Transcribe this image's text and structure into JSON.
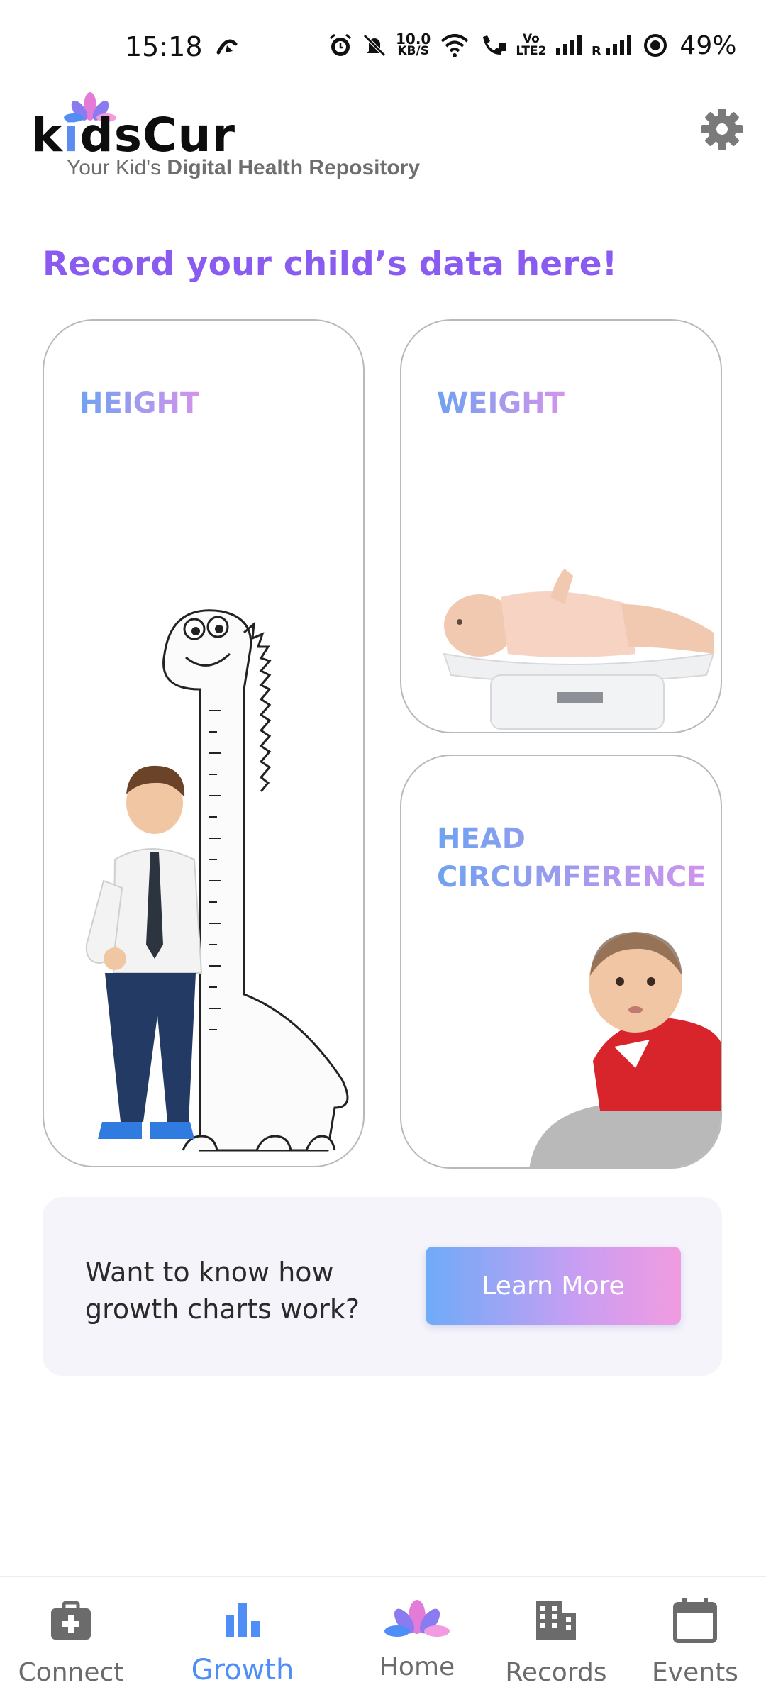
{
  "status_bar": {
    "time": "15:18",
    "net_speed_value": "10.0",
    "net_speed_unit": "KB/S",
    "volte": "Vo",
    "lte": "LTE2",
    "battery": "49%",
    "icons": [
      "hotspot-icon",
      "alarm-icon",
      "mute-icon",
      "wifi-icon",
      "wifi-call-icon",
      "signal-icon",
      "roaming-signal-icon",
      "battery-saver-icon"
    ]
  },
  "header": {
    "logo_text_prefix": "k",
    "logo_text_accent": "i",
    "logo_text_suffix": "dsCur",
    "tagline_prefix": "Your Kid's ",
    "tagline_bold": "Digital Health Repository",
    "settings_icon": "gear-icon"
  },
  "main": {
    "title": "Record your child’s data here!",
    "cards": {
      "height": {
        "label": "HEIGHT"
      },
      "weight": {
        "label": "WEIGHT"
      },
      "head": {
        "label": "HEAD CIRCUMFERENCE"
      }
    }
  },
  "info_banner": {
    "text": "Want to know how growth charts work?",
    "button_label": "Learn More"
  },
  "bottom_nav": {
    "items": [
      {
        "label": "Connect",
        "icon": "medical-bag-icon",
        "active": false
      },
      {
        "label": "Growth",
        "icon": "bar-chart-icon",
        "active": true
      },
      {
        "label": "Home",
        "icon": "lotus-icon",
        "active": false
      },
      {
        "label": "Records",
        "icon": "building-icon",
        "active": false
      },
      {
        "label": "Events",
        "icon": "calendar-icon",
        "active": false
      }
    ]
  },
  "colors": {
    "accent_purple": "#8a5bf0",
    "active_blue": "#4f8ef7",
    "gradient_start": "#6eabf8",
    "gradient_end": "#f19be0"
  }
}
